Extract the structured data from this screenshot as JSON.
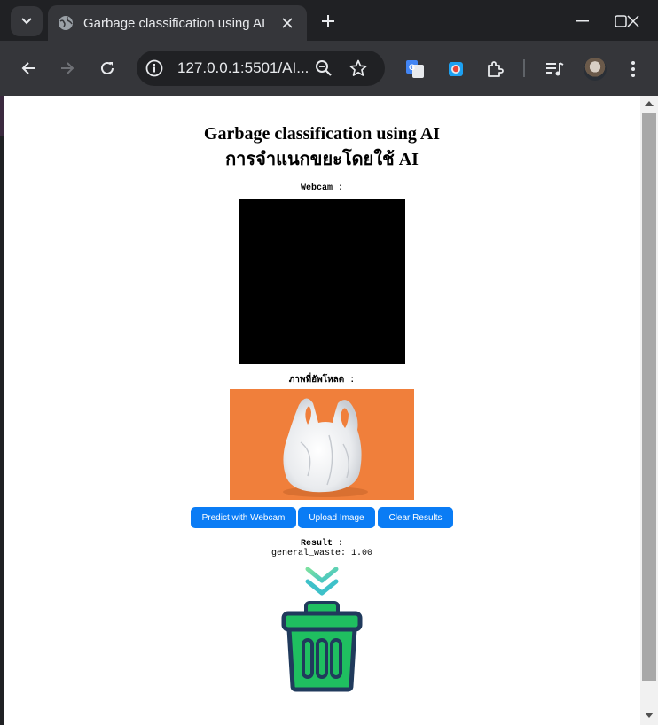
{
  "browser": {
    "tab_title": "Garbage classification using AI",
    "url": "127.0.0.1:5501/AI...",
    "accent": "#0a7cf5"
  },
  "page": {
    "title_en": "Garbage classification using AI",
    "title_th": "การจำแนกขยะโดยใช้ AI",
    "webcam_label": "Webcam :",
    "uploaded_label": "ภาพที่อัพโหลด :",
    "buttons": {
      "predict_webcam": "Predict with Webcam",
      "upload_image": "Upload Image",
      "clear_results": "Clear Results"
    },
    "result_label": "Result :",
    "result_value": "general_waste: 1.00",
    "result_icon": "green-trash-bin-icon"
  }
}
